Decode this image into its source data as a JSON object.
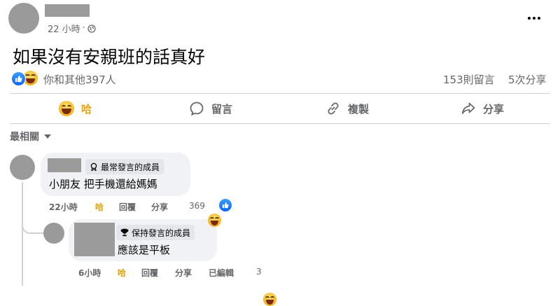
{
  "post": {
    "time": "22 小時",
    "text": "如果沒有安親班的話真好",
    "reactions_text": "你和其他397人",
    "comments_count": "153則留言",
    "shares_count": "5次分享"
  },
  "actions": {
    "react_label": "哈",
    "comment_label": "留言",
    "copy_label": "複製",
    "share_label": "分享"
  },
  "sort": {
    "label": "最相關"
  },
  "comments": [
    {
      "badge": "最常發言的成員",
      "text": "小朋友 把手機還給媽媽",
      "time": "22小時",
      "react": "哈",
      "reply": "回覆",
      "share": "分享",
      "reaction_count": "369"
    }
  ],
  "reply": {
    "badge": "保持發言的成員",
    "text": "應該是平板",
    "time": "6小時",
    "react": "哈",
    "reply": "回覆",
    "share": "分享",
    "edited": "已編輯",
    "reaction_count": "3"
  },
  "colors": {
    "accent": "#0866ff",
    "haha": "#f7b928",
    "muted": "#65676b",
    "bubble": "#f0f2f5"
  }
}
